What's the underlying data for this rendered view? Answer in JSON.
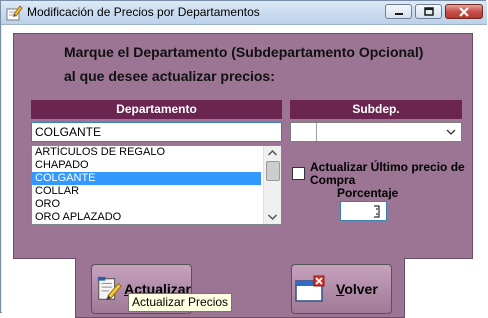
{
  "window": {
    "title": "Modificación de Precios por Departamentos"
  },
  "instructions": {
    "line1": "Marque el Departamento (Subdepartamento Opcional)",
    "line2": "al que desee actualizar precios:"
  },
  "departamento": {
    "header": "Departamento",
    "input_value": "COLGANTE",
    "items": [
      "ARTÍCULOS DE REGALO",
      "CHAPADO",
      "COLGANTE",
      "COLLAR",
      "ORO",
      "ORO APLAZADO"
    ],
    "selected": "COLGANTE"
  },
  "subdep": {
    "header": "Subdep.",
    "value": ""
  },
  "update_last_price": {
    "label": "Actualizar Último precio de Compra",
    "checked": false
  },
  "porcentaje": {
    "label": "Porcentaje",
    "value": ""
  },
  "buttons": {
    "actualizar_prefix": "",
    "actualizar_u": "A",
    "actualizar_rest": "ctualizar",
    "volver_u": "V",
    "volver_rest": "olver"
  },
  "tooltip": "Actualizar Precios",
  "colors": {
    "panel": "#9b7593",
    "header": "#6a2650",
    "selection": "#3399ff"
  }
}
